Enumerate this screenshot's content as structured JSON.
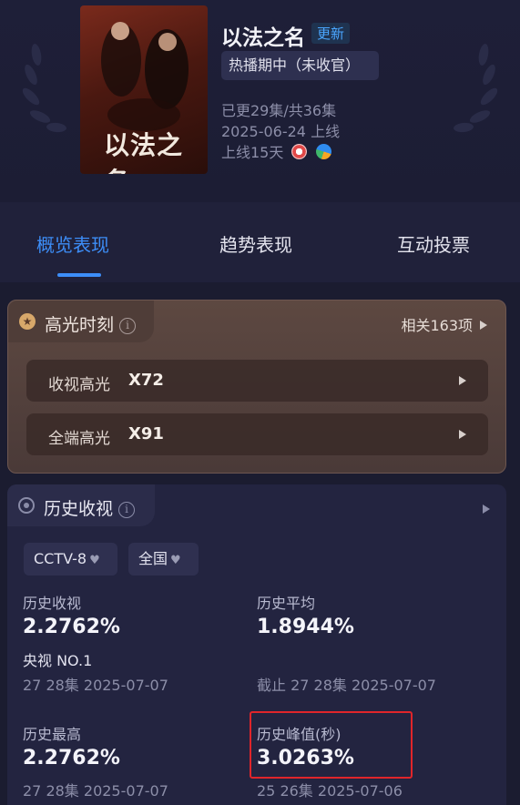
{
  "show": {
    "title": "以法之名",
    "badge": "更新",
    "status": "热播期中（未收官）",
    "episodes": "已更29集/共36集",
    "release": "2025-06-24 上线",
    "days_online": "上线15天",
    "poster_text": "以法之名"
  },
  "tabs": [
    {
      "label": "概览表现",
      "active": true
    },
    {
      "label": "趋势表现",
      "active": false
    },
    {
      "label": "互动投票",
      "active": false
    }
  ],
  "highlights": {
    "title": "高光时刻",
    "related": "相关163项",
    "rows": [
      {
        "label": "收视高光",
        "value": "X72"
      },
      {
        "label": "全端高光",
        "value": "X91"
      }
    ]
  },
  "history": {
    "title": "历史收视",
    "filters": {
      "channel": "CCTV-8",
      "region": "全国"
    },
    "stats": {
      "history_rating": {
        "label": "历史收视",
        "value": "2.2762%",
        "note": "央视 NO.1",
        "sub": "27 28集 2025-07-07"
      },
      "history_avg": {
        "label": "历史平均",
        "value": "1.8944%",
        "sub": "截止 27 28集 2025-07-07"
      },
      "history_max": {
        "label": "历史最高",
        "value": "2.2762%",
        "sub": "27 28集 2025-07-07"
      },
      "history_peak": {
        "label": "历史峰值(秒)",
        "value": "3.0263%",
        "sub": "25 26集 2025-07-06"
      }
    }
  },
  "colors": {
    "accent": "#3d8ef8",
    "highlight_box": "#e0252a"
  },
  "icons": {
    "info": "info-icon",
    "highlight": "star-badge-icon",
    "history": "target-icon",
    "more": "triangle-right-icon"
  }
}
